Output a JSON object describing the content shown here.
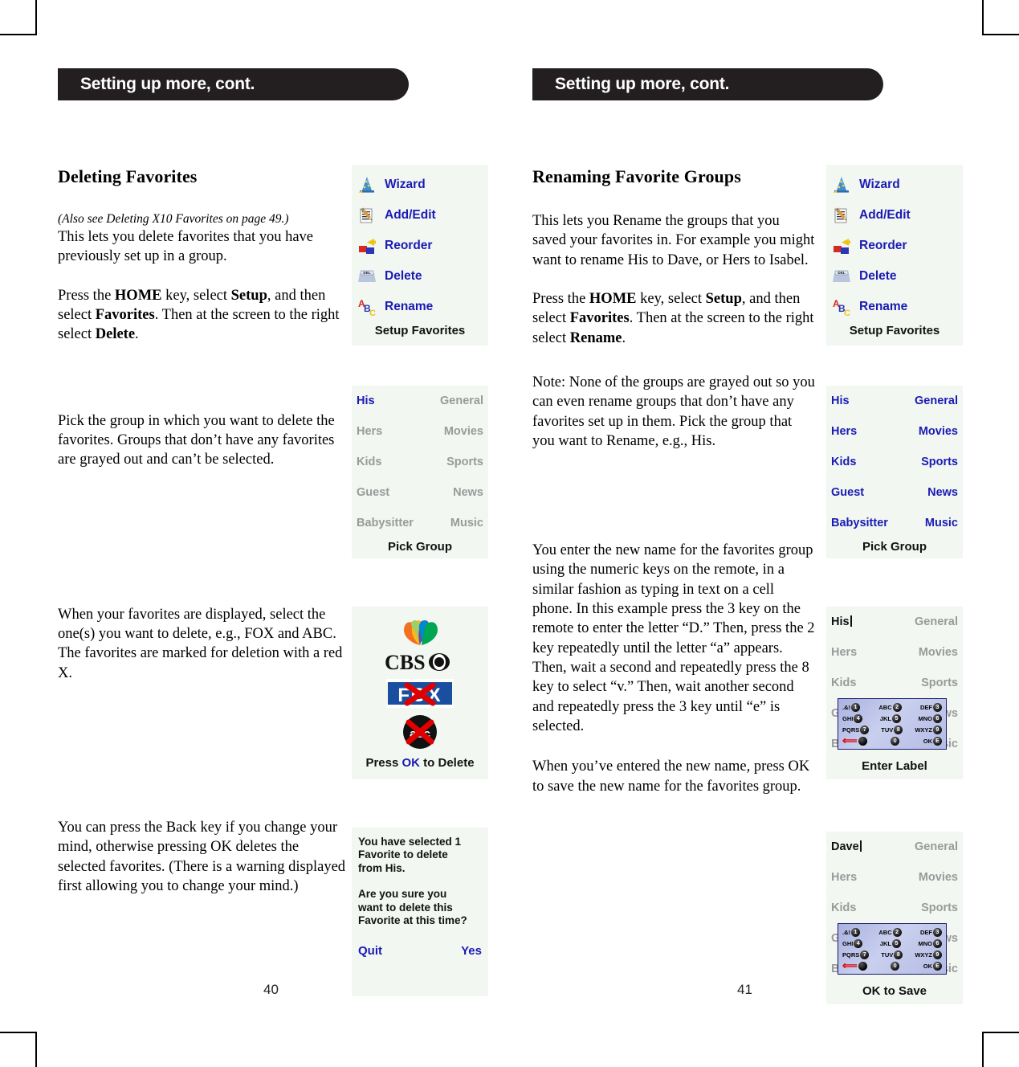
{
  "document": {
    "page_numbers": {
      "left": "40",
      "right": "41"
    }
  },
  "left_page": {
    "banner": "Setting up more, cont.",
    "heading": "Deleting Favorites",
    "paragraphs": {
      "intro_italic": "(Also see Deleting X10 Favorites on page 49.)",
      "intro_rest": "This lets you delete favorites that you have previously set up in a group.",
      "press_home_1": "Press the ",
      "press_home_bold1": "HOME",
      "press_home_2": " key, select ",
      "press_home_bold2": "Setup",
      "press_home_3": ", and then select ",
      "press_home_bold3": "Favorites",
      "press_home_4": ". Then at the screen to the right select ",
      "press_home_bold4": "Delete",
      "press_home_5": ".",
      "pick_group": "Pick the group in which you want to delete the favorites. Groups that don’t have any favorites are grayed out and can’t be selected.",
      "when_displayed": "When your favorites are displayed, select the one(s) you want to delete, e.g., FOX and ABC. The favorites are marked for deletion with a red X.",
      "back_key": "You can press the Back key if you change your mind, otherwise pressing OK deletes the selected favorites. (There is a warning displayed first allowing you to change your mind.)"
    },
    "setup_menu": {
      "items": [
        {
          "label": "Wizard",
          "icon": "wizard-hat-icon"
        },
        {
          "label": "Add/Edit",
          "icon": "pencil-list-icon"
        },
        {
          "label": "Reorder",
          "icon": "reorder-arrow-blocks-icon"
        },
        {
          "label": "Delete",
          "icon": "del-key-icon"
        },
        {
          "label": "Rename",
          "icon": "abc-letters-icon"
        }
      ],
      "caption": "Setup Favorites"
    },
    "pick_group_screen": {
      "rows": [
        {
          "left": "His",
          "left_state": "selected",
          "right": "General",
          "right_state": "disabled"
        },
        {
          "left": "Hers",
          "left_state": "disabled",
          "right": "Movies",
          "right_state": "disabled"
        },
        {
          "left": "Kids",
          "left_state": "disabled",
          "right": "Sports",
          "right_state": "disabled"
        },
        {
          "left": "Guest",
          "left_state": "disabled",
          "right": "News",
          "right_state": "disabled"
        },
        {
          "left": "Babysitter",
          "left_state": "disabled",
          "right": "Music",
          "right_state": "disabled"
        }
      ],
      "caption": "Pick Group"
    },
    "favorites_screen": {
      "logos": [
        "nbc-peacock-logo",
        "cbs-eye-logo",
        "fox-logo-marked",
        "abc-logo-marked"
      ],
      "caption_before": "Press ",
      "caption_ok": "OK",
      "caption_after": " to Delete"
    },
    "confirm_screen": {
      "line1": "You have selected 1",
      "line2": "Favorite to delete",
      "line3": "from His.",
      "line4": "Are you sure you",
      "line5": "want to delete this",
      "line6": "Favorite at this time?",
      "quit": "Quit",
      "yes": "Yes"
    }
  },
  "right_page": {
    "banner": "Setting up more, cont.",
    "heading": "Renaming Favorite Groups",
    "paragraphs": {
      "intro": "This lets you Rename the groups that you saved your favorites in. For example you might want to rename His to Dave, or Hers to Isabel.",
      "press_home_1": "Press the ",
      "press_home_bold1": "HOME",
      "press_home_2": " key, select ",
      "press_home_bold2": "Setup",
      "press_home_3": ", and then select ",
      "press_home_bold3": "Favorites",
      "press_home_4": ". Then at the screen to the right select ",
      "press_home_bold4": "Rename",
      "press_home_5": ".",
      "note": "Note: None of the groups are grayed out so you can even rename groups that don’t have any favorites set up in them. Pick the group that you want to Rename, e.g., His.",
      "enter_name": "You enter the new name for the favorites group using the numeric keys on the remote, in a similar fashion as typing in text on a cell phone. In this example press the 3 key on the remote to enter the letter “D.” Then, press the 2 key repeatedly until the letter “a” appears. Then, wait a second and repeatedly press the 8 key to select “v.” Then, wait another second and repeatedly press the 3 key until “e” is selected.",
      "save": "When you’ve entered the new name, press OK to save the new name for the favorites group."
    },
    "setup_menu": {
      "items": [
        {
          "label": "Wizard",
          "icon": "wizard-hat-icon"
        },
        {
          "label": "Add/Edit",
          "icon": "pencil-list-icon"
        },
        {
          "label": "Reorder",
          "icon": "reorder-arrow-blocks-icon"
        },
        {
          "label": "Delete",
          "icon": "del-key-icon"
        },
        {
          "label": "Rename",
          "icon": "abc-letters-icon"
        }
      ],
      "caption": "Setup Favorites"
    },
    "pick_group_screen": {
      "rows": [
        {
          "left": "His",
          "left_state": "enabled",
          "right": "General",
          "right_state": "enabled"
        },
        {
          "left": "Hers",
          "left_state": "enabled",
          "right": "Movies",
          "right_state": "enabled"
        },
        {
          "left": "Kids",
          "left_state": "enabled",
          "right": "Sports",
          "right_state": "enabled"
        },
        {
          "left": "Guest",
          "left_state": "enabled",
          "right": "News",
          "right_state": "enabled"
        },
        {
          "left": "Babysitter",
          "left_state": "enabled",
          "right": "Music",
          "right_state": "enabled"
        }
      ],
      "caption": "Pick Group"
    },
    "enter_label_screen": {
      "edit_value": "His",
      "rows": [
        {
          "left": "His",
          "right": "General"
        },
        {
          "left": "Hers",
          "right": "Movies"
        },
        {
          "left": "Kids",
          "right": "Sports"
        },
        {
          "left": "Guest",
          "right": "News"
        },
        {
          "left": "Babysitter",
          "right": "Music"
        }
      ],
      "caption": "Enter Label"
    },
    "ok_to_save_screen": {
      "edit_value": "Dave",
      "rows": [
        {
          "left": "Dave",
          "right": "General"
        },
        {
          "left": "Hers",
          "right": "Movies"
        },
        {
          "left": "Kids",
          "right": "Sports"
        },
        {
          "left": "Guest",
          "right": "News"
        },
        {
          "left": "Babysitter",
          "right": "Music"
        }
      ],
      "caption": "OK to Save"
    }
  },
  "keypad": {
    "rows": [
      [
        {
          "label": ".&!",
          "key": "1"
        },
        {
          "label": "ABC",
          "key": "2"
        },
        {
          "label": "DEF",
          "key": "3"
        }
      ],
      [
        {
          "label": "GHI",
          "key": "4"
        },
        {
          "label": "JKL",
          "key": "5"
        },
        {
          "label": "MNO",
          "key": "6"
        }
      ],
      [
        {
          "label": "PQRS",
          "key": "7"
        },
        {
          "label": "TUV",
          "key": "8"
        },
        {
          "label": "WXYZ",
          "key": "9"
        }
      ],
      [
        {
          "label": "",
          "key": ""
        },
        {
          "label": "",
          "key": "0"
        },
        {
          "label": "OK",
          "key": "E"
        }
      ]
    ],
    "back_arrow_icon": "back-arrow-icon"
  },
  "colors": {
    "banner_bg": "#231f20",
    "screen_bg": "#f2f7f2",
    "menu_blue": "#1b1bb3",
    "disabled_gray": "#9a9a9a",
    "delete_mark_red": "#e00000"
  }
}
